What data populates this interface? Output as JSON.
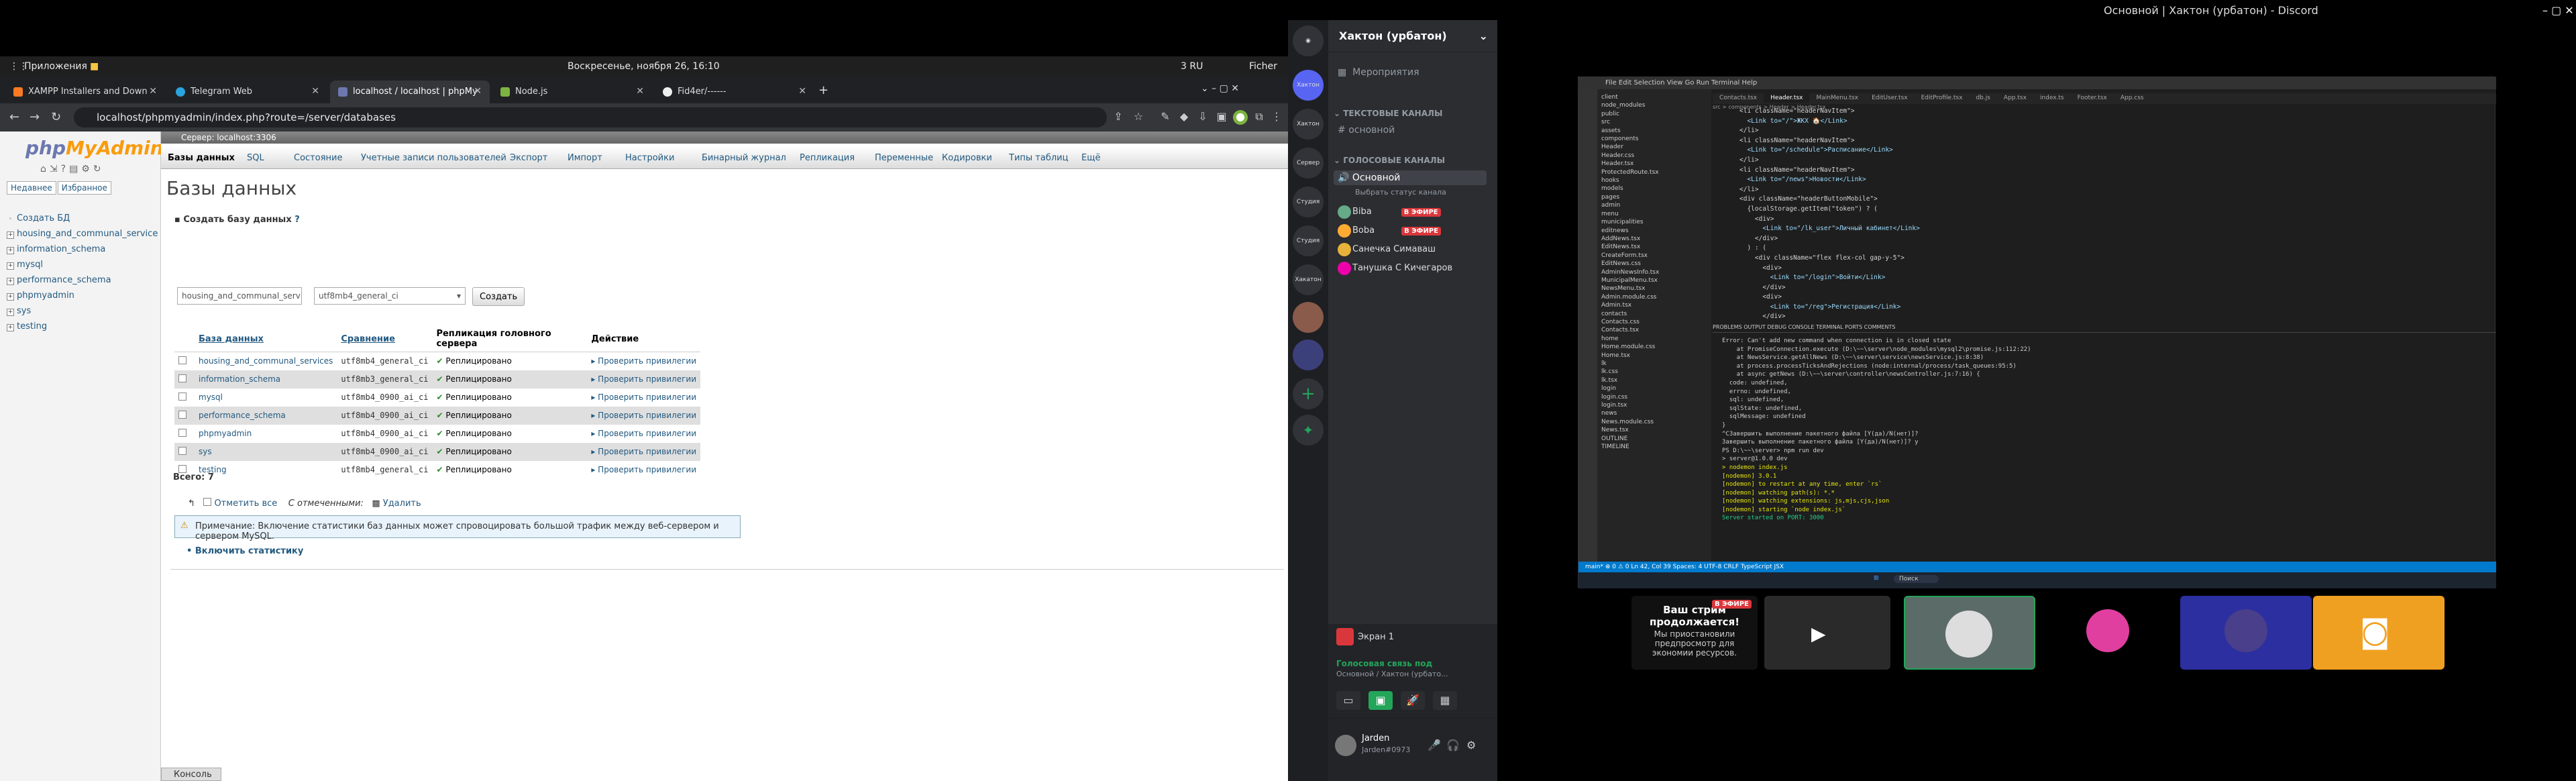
{
  "topbar": {
    "apps": "Приложения",
    "clock": "Воскресенье, ноября 26, 16:10",
    "discord_window_title": "Основной | Хактон (урбатон) - Discord"
  },
  "browser_bar": {
    "tray": "3  RU",
    "user": "Ficher"
  },
  "tabs": [
    {
      "label": "XAMPP Installers and Down",
      "color": "#fb7a24"
    },
    {
      "label": "Telegram Web",
      "color": "#2aa3df"
    },
    {
      "label": "localhost / localhost | phpMy",
      "color": "#6c78af"
    },
    {
      "label": "Node.js",
      "color": "#7cb342"
    },
    {
      "label": "Fid4er/------",
      "color": "#eeeeee"
    }
  ],
  "address": {
    "url": "localhost/phpmyadmin/index.php?route=/server/databases"
  },
  "pma": {
    "logo_a": "php",
    "logo_b": "MyAdmin",
    "nav_tabs": [
      "Недавнее",
      "Избранное"
    ],
    "tree": [
      "Создать БД",
      "housing_and_communal_service",
      "information_schema",
      "mysql",
      "performance_schema",
      "phpmyadmin",
      "sys",
      "testing"
    ],
    "server_crumb": "Сервер: localhost:3306",
    "menu": [
      "Базы данных",
      "SQL",
      "Состояние",
      "Учетные записи пользователей",
      "Экспорт",
      "Импорт",
      "Настройки",
      "Бинарный журнал",
      "Репликация",
      "Переменные",
      "Кодировки",
      "Типы таблиц",
      "Ещё"
    ],
    "title": "Базы данных",
    "create_label": "Создать базу данных",
    "create_input_value": "housing_and_communal_serv",
    "collation_value": "utf8mb4_general_ci",
    "create_button": "Создать",
    "columns": [
      "База данных",
      "Сравнение",
      "Репликация головного сервера",
      "Действие"
    ],
    "rows": [
      {
        "db": "housing_and_communal_services",
        "coll": "utf8mb4_general_ci",
        "repl": "Реплицировано",
        "act": "Проверить привилегии"
      },
      {
        "db": "information_schema",
        "coll": "utf8mb3_general_ci",
        "repl": "Реплицировано",
        "act": "Проверить привилегии"
      },
      {
        "db": "mysql",
        "coll": "utf8mb4_0900_ai_ci",
        "repl": "Реплицировано",
        "act": "Проверить привилегии"
      },
      {
        "db": "performance_schema",
        "coll": "utf8mb4_0900_ai_ci",
        "repl": "Реплицировано",
        "act": "Проверить привилегии"
      },
      {
        "db": "phpmyadmin",
        "coll": "utf8mb4_0900_ai_ci",
        "repl": "Реплицировано",
        "act": "Проверить привилегии"
      },
      {
        "db": "sys",
        "coll": "utf8mb4_0900_ai_ci",
        "repl": "Реплицировано",
        "act": "Проверить привилегии"
      },
      {
        "db": "testing",
        "coll": "utf8mb4_general_ci",
        "repl": "Реплицировано",
        "act": "Проверить привилегии"
      }
    ],
    "total": "Всего: 7",
    "check_all": "Отметить все",
    "with_selected": "С отмеченными:",
    "delete": "Удалить",
    "note": "Примечание: Включение статистики баз данных может спровоцировать большой трафик между веб-сервером и сервером MySQL.",
    "enable_stats": "Включить статистику",
    "console": "Консоль"
  },
  "discord": {
    "server_name": "Хактон (урбатон)",
    "events": "Мероприятия",
    "text_cat": "ТЕКСТОВЫЕ КАНАЛЫ",
    "text_channel": "основной",
    "voice_cat": "ГОЛОСОВЫЕ КАНАЛЫ",
    "voice_channel": "Основной",
    "status_hint": "Выбрать статус канала",
    "users": [
      "Biba",
      "Boba",
      "Санечка Симаваш",
      "Танушка С Кичегаров"
    ],
    "live": "В ЭФИРЕ",
    "servers": [
      "Хактон",
      "Сервер",
      "Студия",
      "Студия",
      "Хакатон"
    ],
    "screen": "Экран 1",
    "voice_connected": "Голосовая связь под",
    "voice_sub": "Основной / Хактон (урбато...",
    "me_name": "Jarden",
    "me_tag": "Jarden#0973",
    "stream_title": "Ваш стрим продолжается!",
    "stream_text": "Мы приостановили предпросмотр для экономии ресурсов."
  },
  "vscode": {
    "tabs": [
      "Contacts.tsx",
      "Header.tsx",
      "MainMenu.tsx",
      "EditUser.tsx",
      "EditProfile.tsx",
      "db.js",
      "App.tsx",
      "index.ts",
      "Footer.tsx",
      "App.css"
    ],
    "breadcrumb": "src > components > Header > Header.tsx",
    "tree": [
      "client",
      "node_modules",
      "public",
      "src",
      "assets",
      "components",
      "Header",
      "Header.css",
      "Header.tsx",
      "ProtectedRoute.tsx",
      "hooks",
      "models",
      "pages",
      "admin",
      "menu",
      "municipalities",
      "editnews",
      "AddNews.tsx",
      "EditNews.tsx",
      "CreateForm.tsx",
      "EditNews.css",
      "AdminNewsInfo.tsx",
      "MunicipalMenu.tsx",
      "NewsMenu.tsx",
      "Admin.module.css",
      "Admin.tsx",
      "contacts",
      "Contacts.css",
      "Contacts.tsx",
      "home",
      "Home.module.css",
      "Home.tsx",
      "lk",
      "lk.css",
      "lk.tsx",
      "login",
      "login.css",
      "login.tsx",
      "news",
      "News.module.css",
      "News.tsx",
      "OUTLINE",
      "TIMELINE"
    ],
    "code": [
      "<li className=\"headerNavItem\">",
      "  <Link to=\"/\">ЖКХ 🏠</Link>",
      "</li>",
      "<li className=\"headerNavItem\">",
      "  <Link to=\"/schedule\">Расписание</Link>",
      "</li>",
      "<li className=\"headerNavItem\">",
      "  <Link to=\"/news\">Новости</Link>",
      "</li>",
      "<div className=\"headerButtonMobile\">",
      "  {localStorage.getItem(\"token\") ? (",
      "    <div>",
      "      <Link to=\"/lk_user\">Личный кабинет</Link>",
      "    </div>",
      "  ) : (",
      "    <div className=\"flex flex-col gap-y-5\">",
      "      <div>",
      "        <Link to=\"/login\">Войти</Link>",
      "      </div>",
      "      <div>",
      "        <Link to=\"/reg\">Регистрация</Link>",
      "      </div>"
    ],
    "panel_tabs": "PROBLEMS   OUTPUT   DEBUG CONSOLE   TERMINAL   PORTS   COMMENTS",
    "terminal": [
      "Error: Can't add new command when connection is in closed state",
      "    at PromiseConnection.execute (D:\\~~\\server\\node_modules\\mysql2\\promise.js:112:22)",
      "    at NewsService.getAllNews (D:\\~~\\server\\service\\newsService.js:8:38)",
      "    at process.processTicksAndRejections (node:internal/process/task_queues:95:5)",
      "    at async getNews (D:\\~~\\server\\controller\\newsController.js:7:16) {",
      "  code: undefined,",
      "  errno: undefined,",
      "  sql: undefined,",
      "  sqlState: undefined,",
      "  sqlMessage: undefined",
      "}",
      "^CЗавершить выполнение пакетного файла [Y(да)/N(нет)]?",
      "Завершить выполнение пакетного файла [Y(да)/N(нет)]? y",
      "PS D:\\~~\\server> npm run dev",
      "",
      "> server@1.0.0 dev",
      "> nodemon index.js",
      "",
      "[nodemon] 3.0.1",
      "[nodemon] to restart at any time, enter `rs`",
      "[nodemon] watching path(s): *.*",
      "[nodemon] watching extensions: js,mjs,cjs,json",
      "[nodemon] starting `node index.js`",
      "Server started on PORT: 3000"
    ],
    "status": "main*   ⊗ 0 ⚠ 0   Ln 42, Col 39   Spaces: 4   UTF-8   CRLF   TypeScript JSX",
    "search": "Поиск"
  }
}
